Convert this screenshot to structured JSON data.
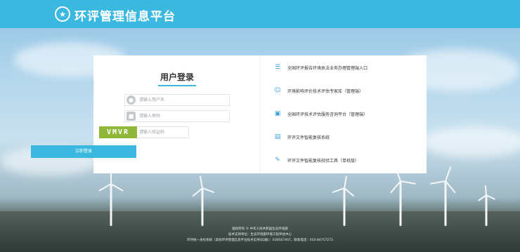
{
  "header": {
    "title": "环评管理信息平台",
    "logo_icon": "emblem-icon"
  },
  "login": {
    "title": "用户登录",
    "username_placeholder": "请输入用户名",
    "password_placeholder": "请输入密码",
    "captcha_placeholder": "请输入验证码",
    "captcha_text": "VMVR",
    "submit_label": "立即登录"
  },
  "menu": {
    "items": [
      {
        "label": "全国环评报告环境执法业务办理管理端入口",
        "icon": "list-icon"
      },
      {
        "label": "环境影响评价技术评估专家库（管理端）",
        "icon": "user-icon"
      },
      {
        "label": "全国环评技术评估服务咨询平台（管理端）",
        "icon": "chat-icon"
      },
      {
        "label": "环评文件智能复核系统",
        "icon": "document-icon"
      },
      {
        "label": "环评文件智能复核校验工具（单机版）",
        "icon": "wrench-icon"
      }
    ]
  },
  "footer": {
    "line1": "版权所有 © 中华人民共和国生态环境部",
    "line2": "技术支持单位：生态环境部环境工程评估中心",
    "line3": "环评统一身份系统（高效环评管理信息平台技术支持QQ群）：630567407，联系电话：010-84757273"
  },
  "colors": {
    "accent": "#3bb8e0",
    "captcha_bg": "#8fb83a"
  }
}
